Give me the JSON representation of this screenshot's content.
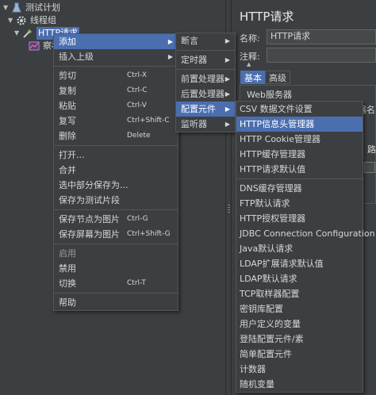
{
  "tree": {
    "items": [
      {
        "label": "测试计划",
        "icon": "flask-icon"
      },
      {
        "label": "线程组",
        "icon": "gear-icon"
      },
      {
        "label": "HTTP请求",
        "icon": "pipette-icon"
      },
      {
        "label": "察看",
        "icon": "graph-icon"
      }
    ]
  },
  "context_menu": {
    "items": [
      {
        "label": "添加",
        "submenu": true
      },
      {
        "label": "插入上级",
        "submenu": true
      },
      {
        "label": "剪切",
        "shortcut": "Ctrl-X"
      },
      {
        "label": "复制",
        "shortcut": "Ctrl-C"
      },
      {
        "label": "粘贴",
        "shortcut": "Ctrl-V"
      },
      {
        "label": "复写",
        "shortcut": "Ctrl+Shift-C"
      },
      {
        "label": "删除",
        "shortcut": "Delete"
      },
      {
        "label": "打开..."
      },
      {
        "label": "合并"
      },
      {
        "label": "选中部分保存为..."
      },
      {
        "label": "保存为测试片段"
      },
      {
        "label": "保存节点为图片",
        "shortcut": "Ctrl-G"
      },
      {
        "label": "保存屏幕为图片",
        "shortcut": "Ctrl+Shift-G"
      },
      {
        "label": "启用"
      },
      {
        "label": "禁用"
      },
      {
        "label": "切换",
        "shortcut": "Ctrl-T"
      },
      {
        "label": "帮助"
      }
    ]
  },
  "add_menu": {
    "items": [
      "断言",
      "定时器",
      "前置处理器",
      "后置处理器",
      "配置元件",
      "监听器"
    ]
  },
  "config_menu": {
    "items": [
      "CSV 数据文件设置",
      "HTTP信息头管理器",
      "HTTP Cookie管理器",
      "HTTP缓存管理器",
      "HTTP请求默认值",
      "DNS缓存管理器",
      "FTP默认请求",
      "HTTP授权管理器",
      "JDBC Connection Configuration",
      "Java默认请求",
      "LDAP扩展请求默认值",
      "LDAP默认请求",
      "TCP取样器配置",
      "密钥库配置",
      "用户定义的变量",
      "登陆配置元件/素",
      "简单配置元件",
      "计数器",
      "随机变量"
    ]
  },
  "right_panel": {
    "title": "HTTP请求",
    "name_label": "名称:",
    "name_value": "HTTP请求",
    "comment_label": "注释:",
    "tabs": [
      "基本",
      "高级"
    ],
    "web_server_label": "Web服务器",
    "partial_right_1": "器名",
    "partial_right_2": "路"
  },
  "colors": {
    "highlight": "#4b6eaf",
    "menu_bg": "#3c3f41",
    "text": "#d6d6d6"
  }
}
